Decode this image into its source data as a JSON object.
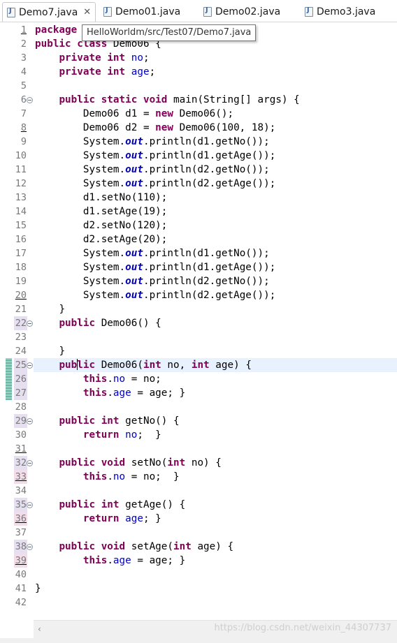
{
  "tabs": [
    {
      "label": "Demo7.java",
      "close": "✕",
      "icon": "java-file-icon"
    },
    {
      "label": "Demo01.java",
      "icon": "java-file-icon"
    },
    {
      "label": "Demo02.java",
      "icon": "java-file-icon"
    },
    {
      "label": "Demo3.java",
      "icon": "java-file-icon"
    }
  ],
  "tooltip": "HelloWorldm/src/Test07/Demo7.java",
  "watermark": "https://blog.csdn.net/weixin_44307737",
  "scroll_left_glyph": "‹",
  "line_numbers": [
    "1",
    "2",
    "3",
    "4",
    "5",
    "6",
    "7",
    "8",
    "9",
    "10",
    "11",
    "12",
    "13",
    "14",
    "15",
    "16",
    "17",
    "18",
    "19",
    "20",
    "21",
    "22",
    "23",
    "24",
    "25",
    "26",
    "27",
    "28",
    "29",
    "30",
    "31",
    "32",
    "33",
    "34",
    "35",
    "36",
    "37",
    "38",
    "39",
    "40",
    "41",
    "42"
  ],
  "colors": {
    "keyword": "#7f0055",
    "field": "#0000c0",
    "current_line": "#e8f2fe",
    "change_bar": "#6bb8a6"
  },
  "code": {
    "l1": {
      "kw": "package"
    },
    "l2": {
      "kw1": "public",
      "kw2": "class",
      "rest": "Demo06 {"
    },
    "l3": {
      "kw1": "private",
      "kw2": "int",
      "fld": "no",
      "rest": ";"
    },
    "l4": {
      "kw1": "private",
      "kw2": "int",
      "fld": "age",
      "rest": ";"
    },
    "l6": {
      "kw1": "public",
      "kw2": "static",
      "kw3": "void",
      "rest": "main(String[] args) {"
    },
    "l7": {
      "a": "Demo06 d1 = ",
      "kw": "new",
      "b": "Demo06();"
    },
    "l8": {
      "a": "Demo06 d2 = ",
      "kw": "new",
      "b": "Demo06(100, 18);"
    },
    "l9": {
      "a": "System.",
      "sf": "out",
      "b": ".println(d1.getNo());"
    },
    "l10": {
      "a": "System.",
      "sf": "out",
      "b": ".println(d1.getAge());"
    },
    "l11": {
      "a": "System.",
      "sf": "out",
      "b": ".println(d2.getNo());"
    },
    "l12": {
      "a": "System.",
      "sf": "out",
      "b": ".println(d2.getAge());"
    },
    "l13": "d1.setNo(110);",
    "l14": "d1.setAge(19);",
    "l15": "d2.setNo(120);",
    "l16": "d2.setAge(20);",
    "l17": {
      "a": "System.",
      "sf": "out",
      "b": ".println(d1.getNo());"
    },
    "l18": {
      "a": "System.",
      "sf": "out",
      "b": ".println(d1.getAge());"
    },
    "l19": {
      "a": "System.",
      "sf": "out",
      "b": ".println(d2.getNo());"
    },
    "l20": {
      "a": "System.",
      "sf": "out",
      "b": ".println(d2.getAge());"
    },
    "l21": "}",
    "l22": {
      "kw": "public",
      "rest": "Demo06() {"
    },
    "l24": "}",
    "l25": {
      "kw1a": "pub",
      "kw1b": "lic",
      "a": "Demo06(",
      "kw2": "int",
      "b": "no, ",
      "kw3": "int",
      "c": "age) {"
    },
    "l26": {
      "kw": "this",
      "a": ".",
      "fld": "no",
      "b": " = no;"
    },
    "l27": {
      "kw": "this",
      "a": ".",
      "fld": "age",
      "b": " = age; }"
    },
    "l29": {
      "kw1": "public",
      "kw2": "int",
      "rest": "getNo() {"
    },
    "l30": {
      "kw": "return",
      "fld": "no",
      "rest": ";  }"
    },
    "l32": {
      "kw1": "public",
      "kw2": "void",
      "a": "setNo(",
      "kw3": "int",
      "b": "no) {"
    },
    "l33": {
      "kw": "this",
      "a": ".",
      "fld": "no",
      "b": " = no;  }"
    },
    "l35": {
      "kw1": "public",
      "kw2": "int",
      "rest": "getAge() {"
    },
    "l36": {
      "kw": "return",
      "fld": "age",
      "rest": "; }"
    },
    "l38": {
      "kw1": "public",
      "kw2": "void",
      "a": "setAge(",
      "kw3": "int",
      "b": "age) {"
    },
    "l39": {
      "kw": "this",
      "a": ".",
      "fld": "age",
      "b": " = age; }"
    },
    "l41": "}"
  }
}
